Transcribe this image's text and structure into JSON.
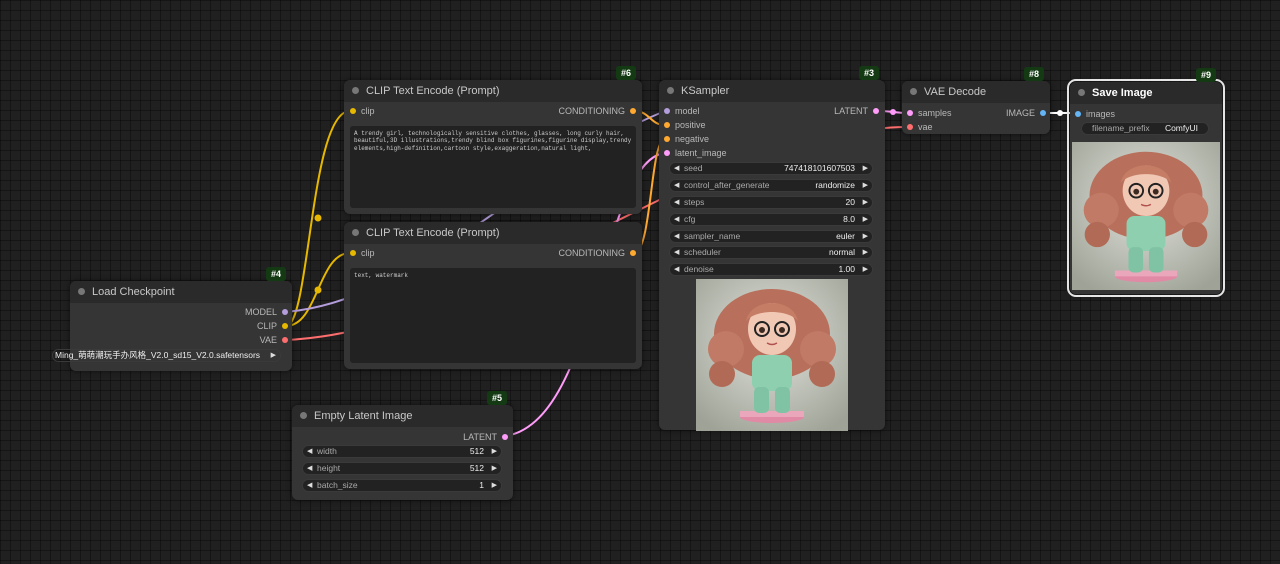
{
  "colors": {
    "clip_wire": "#e6b800",
    "model_wire": "#b39ddb",
    "vae_wire": "#ff6e6e",
    "latent_wire": "#ff9cf9",
    "conditioning_wire": "#ffa931",
    "image_wire": "#64b5f6",
    "background": "#202020",
    "node_body": "#353535"
  },
  "nodes": {
    "clip_pos": {
      "badge": "#6",
      "title": "CLIP Text Encode (Prompt)",
      "input_clip": "clip",
      "output": "CONDITIONING",
      "text": "A trendy girl, technologically sensitive clothes, glasses, long curly hair, beautiful,3D illustrations,trendy blind box figurines,figurine display,trendy elements,high-definition,cartoon style,exaggeration,natural light,"
    },
    "clip_neg": {
      "title": "CLIP Text Encode (Prompt)",
      "input_clip": "clip",
      "output": "CONDITIONING",
      "text": "text, watermark"
    },
    "ksampler": {
      "badge": "#3",
      "title": "KSampler",
      "inputs": [
        "model",
        "positive",
        "negative",
        "latent_image"
      ],
      "output": "LATENT",
      "widgets": [
        {
          "name": "seed",
          "value": "747418101607503"
        },
        {
          "name": "control_after_generate",
          "value": "randomize"
        },
        {
          "name": "steps",
          "value": "20"
        },
        {
          "name": "cfg",
          "value": "8.0"
        },
        {
          "name": "sampler_name",
          "value": "euler"
        },
        {
          "name": "scheduler",
          "value": "normal"
        },
        {
          "name": "denoise",
          "value": "1.00"
        }
      ]
    },
    "vae_decode": {
      "badge": "#8",
      "title": "VAE Decode",
      "input_samples": "samples",
      "input_vae": "vae",
      "output": "IMAGE"
    },
    "save_image": {
      "badge": "#9",
      "title": "Save Image",
      "input_images": "images",
      "widget_name": "filename_prefix",
      "widget_value": "ComfyUI"
    },
    "load_checkpoint": {
      "badge": "#4",
      "title": "Load Checkpoint",
      "outputs": [
        "MODEL",
        "CLIP",
        "VAE"
      ],
      "ckpt_name": "Ming_萌萌潮玩手办风格_V2.0_sd15_V2.0.safetensors"
    },
    "empty_latent": {
      "badge": "#5",
      "title": "Empty Latent Image",
      "output": "LATENT",
      "widgets": [
        {
          "name": "width",
          "value": "512"
        },
        {
          "name": "height",
          "value": "512"
        },
        {
          "name": "batch_size",
          "value": "1"
        }
      ]
    }
  }
}
